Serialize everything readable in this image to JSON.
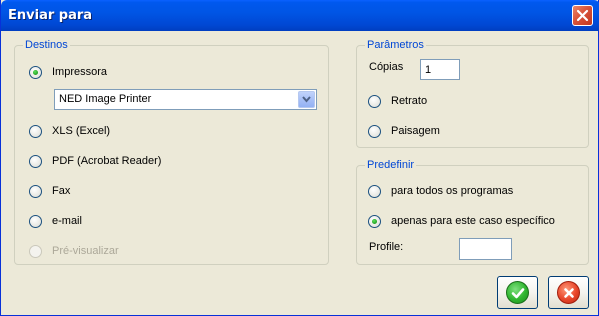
{
  "window": {
    "title": "Enviar para"
  },
  "destinos": {
    "legend": "Destinos",
    "options": [
      {
        "label": "Impressora",
        "checked": true,
        "disabled": false
      },
      {
        "label": "XLS (Excel)",
        "checked": false,
        "disabled": false
      },
      {
        "label": "PDF (Acrobat Reader)",
        "checked": false,
        "disabled": false
      },
      {
        "label": "Fax",
        "checked": false,
        "disabled": false
      },
      {
        "label": "e-mail",
        "checked": false,
        "disabled": false
      },
      {
        "label": "Pré-visualizar",
        "checked": false,
        "disabled": true
      }
    ],
    "printer_select": {
      "value": "NED Image Printer"
    }
  },
  "parametros": {
    "legend": "Parâmetros",
    "copias_label": "Cópias",
    "copias_value": "1",
    "orientation": [
      {
        "label": "Retrato",
        "checked": false
      },
      {
        "label": "Paisagem",
        "checked": false
      }
    ]
  },
  "predefinir": {
    "legend": "Predefinir",
    "options": [
      {
        "label": "para todos os programas",
        "checked": false
      },
      {
        "label": "apenas para este caso específico",
        "checked": true
      }
    ],
    "profile_label": "Profile:",
    "profile_value": ""
  },
  "buttons": {
    "ok": {
      "icon": "checkmark-icon",
      "color": "#2fb52f"
    },
    "cancel": {
      "icon": "x-icon",
      "color": "#e8452a"
    }
  },
  "colors": {
    "titlebar": "#0055e5",
    "legend_text": "#0046d5",
    "dialog_bg": "#ece9d8"
  }
}
